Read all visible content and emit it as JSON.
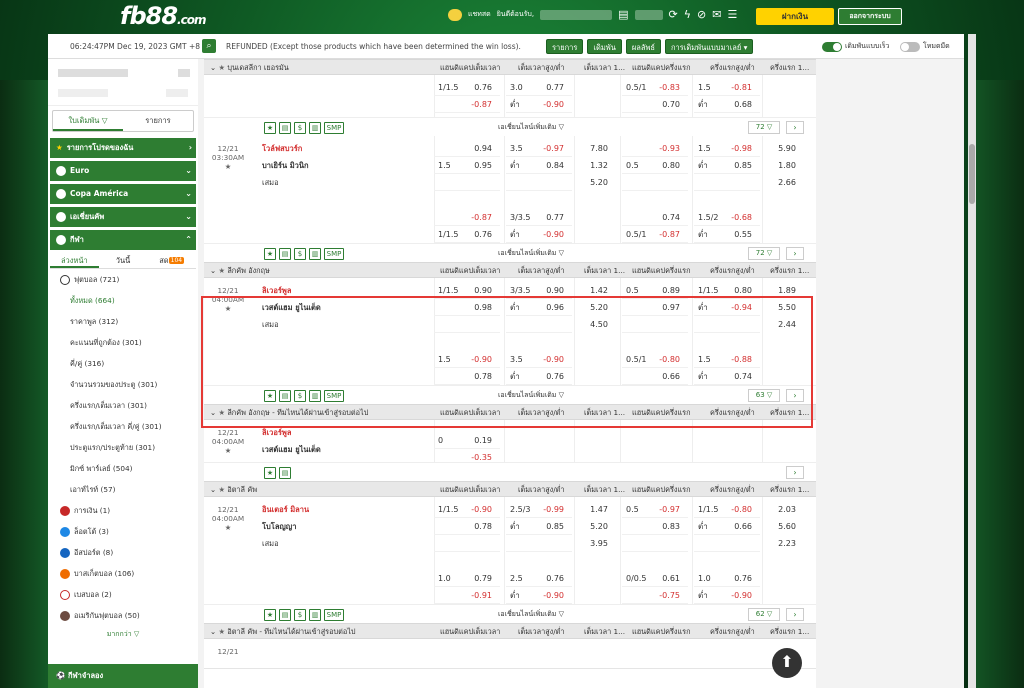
{
  "header": {
    "logo_main": "fb88",
    "logo_suffix": ".com",
    "chat_label": "แชทสด",
    "welcome": "ยินดีต้อนรับ,",
    "deposit_label": "ฝากเงิน",
    "logout_label": "ออกจากระบบ"
  },
  "infobar": {
    "clock": "06:24:47PM Dec 19, 2023 GMT +8",
    "refund_text": "REFUNDED (Except those products which have been determined the win loss).",
    "buttons": [
      "รายการ",
      "เดิมพัน",
      "ผลลัพธ์",
      "การเดิมพันแบบมาเลย์ ▾"
    ],
    "toggle_quick": "เดิมพันแบบเร็ว",
    "toggle_dark": "โหมดมืด"
  },
  "sidebar": {
    "tabs": [
      "ใบเดิมพัน ▽",
      "รายการ"
    ],
    "menu": [
      {
        "label": "รายการโปรดของฉัน"
      },
      {
        "label": "Euro"
      },
      {
        "label": "Copa América"
      },
      {
        "label": "เอเชี่ยนคัพ"
      },
      {
        "label": "กีฬา",
        "badge": ""
      }
    ],
    "subtabs": [
      "ล่วงหน้า",
      "วันนี้",
      "สด"
    ],
    "live_badge": "104",
    "items": [
      {
        "label": "ฟุตบอล (721)"
      },
      {
        "label": "ทั้งหมด (664)"
      },
      {
        "label": "ราคาพูล (312)"
      },
      {
        "label": "คะแนนที่ถูกต้อง (301)"
      },
      {
        "label": "คี่/คู่ (316)"
      },
      {
        "label": "จำนวนรวมของประตู (301)"
      },
      {
        "label": "ครึ่งแรก/เต็มเวลา (301)"
      },
      {
        "label": "ครึ่งแรก/เต็มเวลา คี่/คู่ (301)"
      },
      {
        "label": "ประตูแรก/ประตูท้าย (301)"
      },
      {
        "label": "มิกซ์ พาร์เลย์ (504)"
      },
      {
        "label": "เอาท์ไรท์ (57)"
      },
      {
        "label": "การเงิน (1)"
      },
      {
        "label": "ล็อตโต้ (3)"
      },
      {
        "label": "อีสปอร์ต (8)"
      },
      {
        "label": "บาสเก็ตบอล (106)"
      },
      {
        "label": "เบสบอล (2)"
      },
      {
        "label": "อเมริกันฟุตบอล (50)"
      }
    ],
    "more": "มากกว่า ▽",
    "bottom": "กีฬาจำลอง"
  },
  "columns": {
    "c1": "แฮนดิแคปเต็มเวลา",
    "c2": "เต็มเวลาสูง/ต่ำ",
    "c3": "เต็มเวลา 1...",
    "c4": "แฮนดิแคปครึ่งแรก",
    "c5": "ครึ่งแรกสูง/ต่ำ",
    "c6": "ครึ่งแรก 1..."
  },
  "footer": {
    "more_odds": "เอเชี่ยนไลน์เพิ่มเติม ▽",
    "smp": "SMP"
  },
  "leagues": {
    "bundesliga": "บุนเดสลีกา เยอรมัน",
    "epl": "ลีกคัพ อังกฤษ",
    "epl_next": "ลีกคัพ อังกฤษ - ทีมไหนได้ผ่านเข้าสู่รอบต่อไป",
    "seriea": "อิตาลี คัพ",
    "seriea_next": "อิตาลี คัพ - ทีมไหนได้ผ่านเข้าสู่รอบต่อไป"
  },
  "matches": {
    "m0": {
      "rows": [
        [
          "1/1.5",
          "0.76",
          "3.0",
          "0.77",
          "",
          "0.5/1",
          "-0.83",
          "1.5",
          "-0.81",
          ""
        ],
        [
          "",
          "-0.87",
          "ต่ำ",
          "-0.90",
          "",
          "",
          "0.70",
          "ต่ำ",
          "0.68",
          ""
        ]
      ],
      "count": "72 ▽"
    },
    "m1": {
      "date": "12/21",
      "time": "03:30AM",
      "home": "โวล์ฟสบวร์ก",
      "away": "บาเยิร์น มิวนิก",
      "draw": "เสมอ",
      "r1": [
        "",
        "0.94",
        "3.5",
        "-0.97",
        "7.80",
        "",
        "-0.93",
        "1.5",
        "-0.98",
        "5.90"
      ],
      "r2": [
        "1.5",
        "0.95",
        "ต่ำ",
        "0.84",
        "1.32",
        "0.5",
        "0.80",
        "ต่ำ",
        "0.85",
        "1.80"
      ],
      "r3": [
        "",
        "",
        "",
        "",
        "5.20",
        "",
        "",
        "",
        "",
        "2.66"
      ],
      "r4": [
        "",
        "-0.87",
        "3/3.5",
        "0.77",
        "",
        "",
        "0.74",
        "1.5/2",
        "-0.68",
        ""
      ],
      "r5": [
        "1/1.5",
        "0.76",
        "ต่ำ",
        "-0.90",
        "",
        "0.5/1",
        "-0.87",
        "ต่ำ",
        "0.55",
        ""
      ],
      "count": "72 ▽"
    },
    "m2": {
      "date": "12/21",
      "time": "04:00AM",
      "home": "ลิเวอร์พูล",
      "away": "เวสต์แฮม ยูไนเต็ด",
      "draw": "เสมอ",
      "r1": [
        "1/1.5",
        "0.90",
        "3/3.5",
        "0.90",
        "1.42",
        "0.5",
        "0.89",
        "1/1.5",
        "0.80",
        "1.89"
      ],
      "r2": [
        "",
        "0.98",
        "ต่ำ",
        "0.96",
        "5.20",
        "",
        "0.97",
        "ต่ำ",
        "-0.94",
        "5.50"
      ],
      "r3": [
        "",
        "",
        "",
        "",
        "4.50",
        "",
        "",
        "",
        "",
        "2.44"
      ],
      "r4": [
        "1.5",
        "-0.90",
        "3.5",
        "-0.90",
        "",
        "0.5/1",
        "-0.80",
        "1.5",
        "-0.88",
        ""
      ],
      "r5": [
        "",
        "0.78",
        "ต่ำ",
        "0.76",
        "",
        "",
        "0.66",
        "ต่ำ",
        "0.74",
        ""
      ],
      "count": "63 ▽"
    },
    "m3": {
      "date": "12/21",
      "time": "04:00AM",
      "home": "ลิเวอร์พูล",
      "away": "เวสต์แฮม ยูไนเต็ด",
      "r1": [
        "0",
        "0.19"
      ],
      "r2": [
        "",
        "-0.35"
      ]
    },
    "m4": {
      "date": "12/21",
      "time": "04:00AM",
      "home": "อินเตอร์ มิลาน",
      "away": "โบโลญญา",
      "draw": "เสมอ",
      "r1": [
        "1/1.5",
        "-0.90",
        "2.5/3",
        "-0.99",
        "1.47",
        "0.5",
        "-0.97",
        "1/1.5",
        "-0.80",
        "2.03"
      ],
      "r2": [
        "",
        "0.78",
        "ต่ำ",
        "0.85",
        "5.20",
        "",
        "0.83",
        "ต่ำ",
        "0.66",
        "5.60"
      ],
      "r3": [
        "",
        "",
        "",
        "",
        "3.95",
        "",
        "",
        "",
        "",
        "2.23"
      ],
      "r4": [
        "1.0",
        "0.79",
        "2.5",
        "0.76",
        "",
        "0/0.5",
        "0.61",
        "1.0",
        "0.76",
        ""
      ],
      "r5": [
        "",
        "-0.91",
        "ต่ำ",
        "-0.90",
        "",
        "",
        "-0.75",
        "ต่ำ",
        "-0.90",
        ""
      ],
      "count": "62 ▽"
    },
    "m5": {
      "date": "12/21"
    }
  }
}
